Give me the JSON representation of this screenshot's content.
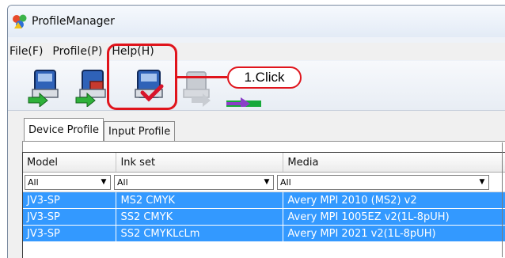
{
  "window": {
    "title": "ProfileManager"
  },
  "menu": [
    {
      "label": "File(F)"
    },
    {
      "label": "Profile(P)"
    },
    {
      "label": "Help(H)"
    }
  ],
  "toolbar": {
    "buttons": [
      {
        "icon": "import-profile-icon",
        "enabled": true
      },
      {
        "icon": "export-profile-icon",
        "enabled": true
      },
      {
        "icon": "delete-profile-icon",
        "enabled": true
      },
      {
        "icon": "copy-profile-icon",
        "enabled": false
      },
      {
        "icon": "send-profile-icon",
        "enabled": true
      }
    ]
  },
  "annotation": {
    "label": "1.Click",
    "color": "#e0141c"
  },
  "tabs": [
    {
      "label": "Device Profile",
      "active": true
    },
    {
      "label": "Input Profile",
      "active": false
    }
  ],
  "grid": {
    "columns": [
      "Model",
      "Ink set",
      "Media"
    ],
    "filters": [
      "All",
      "All",
      "All"
    ],
    "rows": [
      [
        "JV3-SP",
        "MS2 CMYK",
        "Avery MPI 2010 (MS2) v2"
      ],
      [
        "JV3-SP",
        "SS2 CMYK",
        "Avery MPI 1005EZ v2(1L-8pUH)"
      ],
      [
        "JV3-SP",
        "SS2 CMYKLcLm",
        "Avery MPI 2021 v2(1L-8pUH)"
      ]
    ],
    "selection_color": "#3399ff"
  }
}
